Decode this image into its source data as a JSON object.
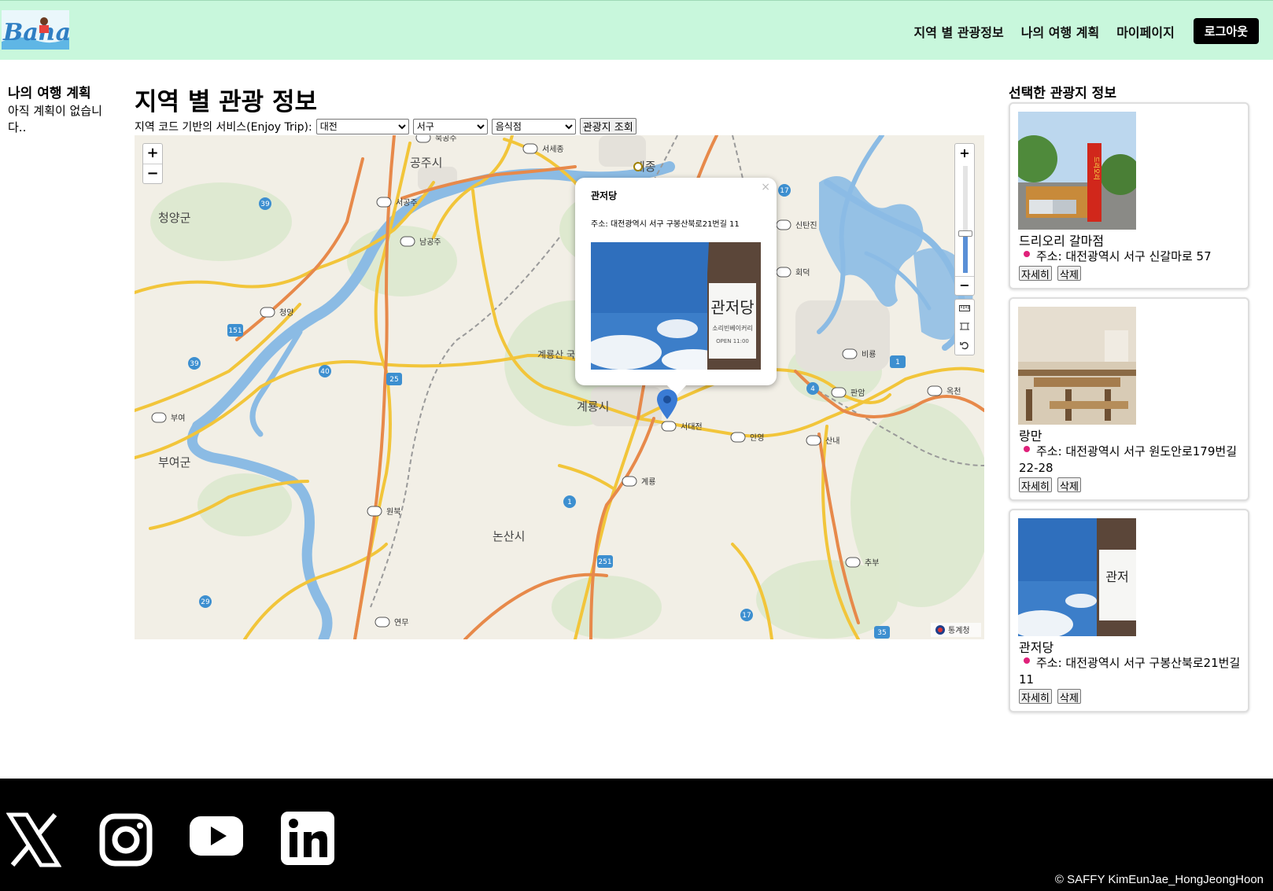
{
  "header": {
    "logo_text": "Baha",
    "nav": [
      "지역 별 관광정보",
      "나의 여행 계획",
      "마이페이지"
    ],
    "logout": "로그아웃"
  },
  "left": {
    "title": "나의 여행 계획",
    "empty": "아직 계획이 없습니다.."
  },
  "main": {
    "title": "지역 별 관광 정보",
    "control_label": "지역 코드 기반의 서비스(Enjoy Trip):",
    "sido_value": "대전",
    "gugun_value": "서구",
    "type_value": "음식점",
    "search_button": "관광지 조회"
  },
  "map": {
    "labels": [
      "공주시",
      "세종",
      "청양군",
      "계룡시",
      "부여군",
      "논산시",
      "계룡산 국립공원"
    ],
    "ic_labels": [
      "북공주",
      "서세종",
      "서공주",
      "남공주",
      "청양",
      "부여",
      "서대전",
      "안영",
      "산내",
      "계룡",
      "원북",
      "연무",
      "추부",
      "옥천",
      "판암",
      "비룡",
      "회덕",
      "신탄진"
    ],
    "road_numbers": [
      "39",
      "151",
      "39",
      "40",
      "25",
      "1",
      "4",
      "1",
      "251",
      "29",
      "17",
      "35",
      "17"
    ],
    "zoom_in": "+",
    "zoom_out": "−",
    "attribution": "통계청",
    "popup": {
      "title": "관저당",
      "address": "주소: 대전광역시 서구 구봉산북로21번길 11",
      "close": "×",
      "sign_text": "관저당",
      "sign_sub": "소리빈베이커리",
      "sign_open": "OPEN 11:00"
    }
  },
  "selected": {
    "title": "선택한 관광지 정보",
    "items": [
      {
        "name": "드리오리 갈마점",
        "address": "주소: 대전광역시 서구 신갈마로 57",
        "detail": "자세히",
        "delete": "삭제",
        "sign": "드리오리"
      },
      {
        "name": "랑만",
        "address": "주소: 대전광역시 서구 원도안로179번길 22-28",
        "detail": "자세히",
        "delete": "삭제"
      },
      {
        "name": "관저당",
        "address": "주소: 대전광역시 서구 구봉산북로21번길 11",
        "detail": "자세히",
        "delete": "삭제",
        "sign": "관저"
      }
    ]
  },
  "footer": {
    "social": [
      "x-icon",
      "instagram-icon",
      "youtube-icon",
      "linkedin-icon"
    ],
    "copyright": "© SAFFY KimEunJae_HongJeongHoon"
  },
  "colors": {
    "header_bg": "#c8f7dc",
    "footer_bg": "#000000",
    "accent_pin": "#3a7bd5",
    "address_dot": "#e0217a"
  }
}
